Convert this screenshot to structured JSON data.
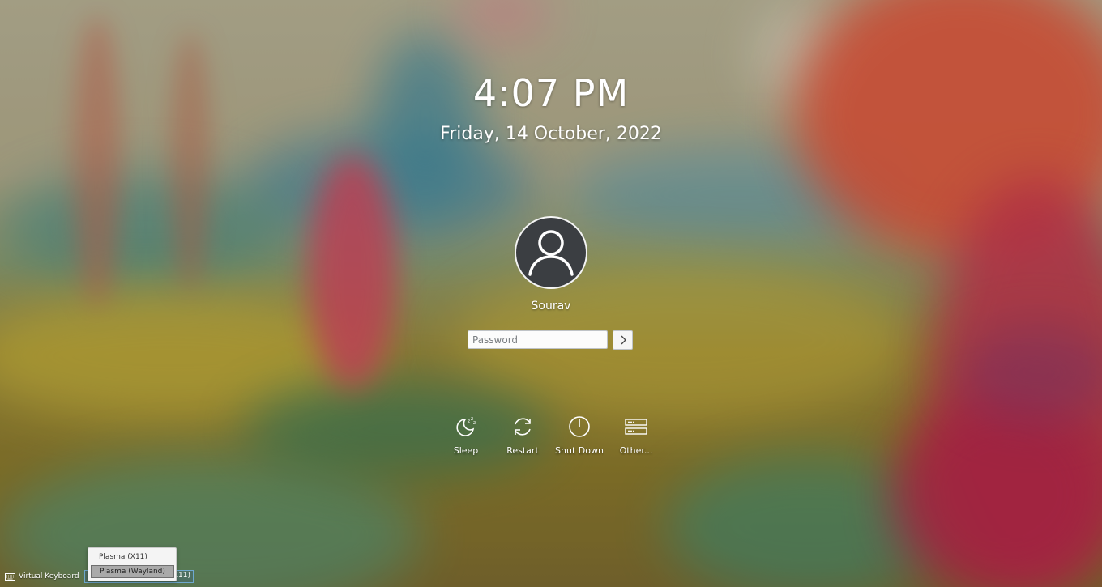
{
  "clock": {
    "time": "4:07 PM",
    "date": "Friday, 14 October, 2022"
  },
  "user": {
    "name": "Sourav",
    "avatar_icon": "user-silhouette-icon"
  },
  "login": {
    "password_placeholder": "Password",
    "password_value": "",
    "submit_icon": "chevron-right-icon"
  },
  "actions": [
    {
      "label": "Sleep",
      "icon": "sleep-icon"
    },
    {
      "label": "Restart",
      "icon": "restart-icon"
    },
    {
      "label": "Shut Down",
      "icon": "power-icon"
    },
    {
      "label": "Other...",
      "icon": "other-icon"
    }
  ],
  "footer": {
    "virtual_keyboard_label": "Virtual Keyboard",
    "keyboard_icon": "keyboard-icon",
    "session_selected_label": "Plasma (X11)",
    "session_options": [
      "Plasma (X11)",
      "Plasma (Wayland)"
    ],
    "session_highlighted": "Plasma (Wayland)"
  },
  "colors": {
    "avatar_bg": "#3b3e42",
    "text": "#ffffff",
    "session_highlight": "#a9a9a9"
  }
}
